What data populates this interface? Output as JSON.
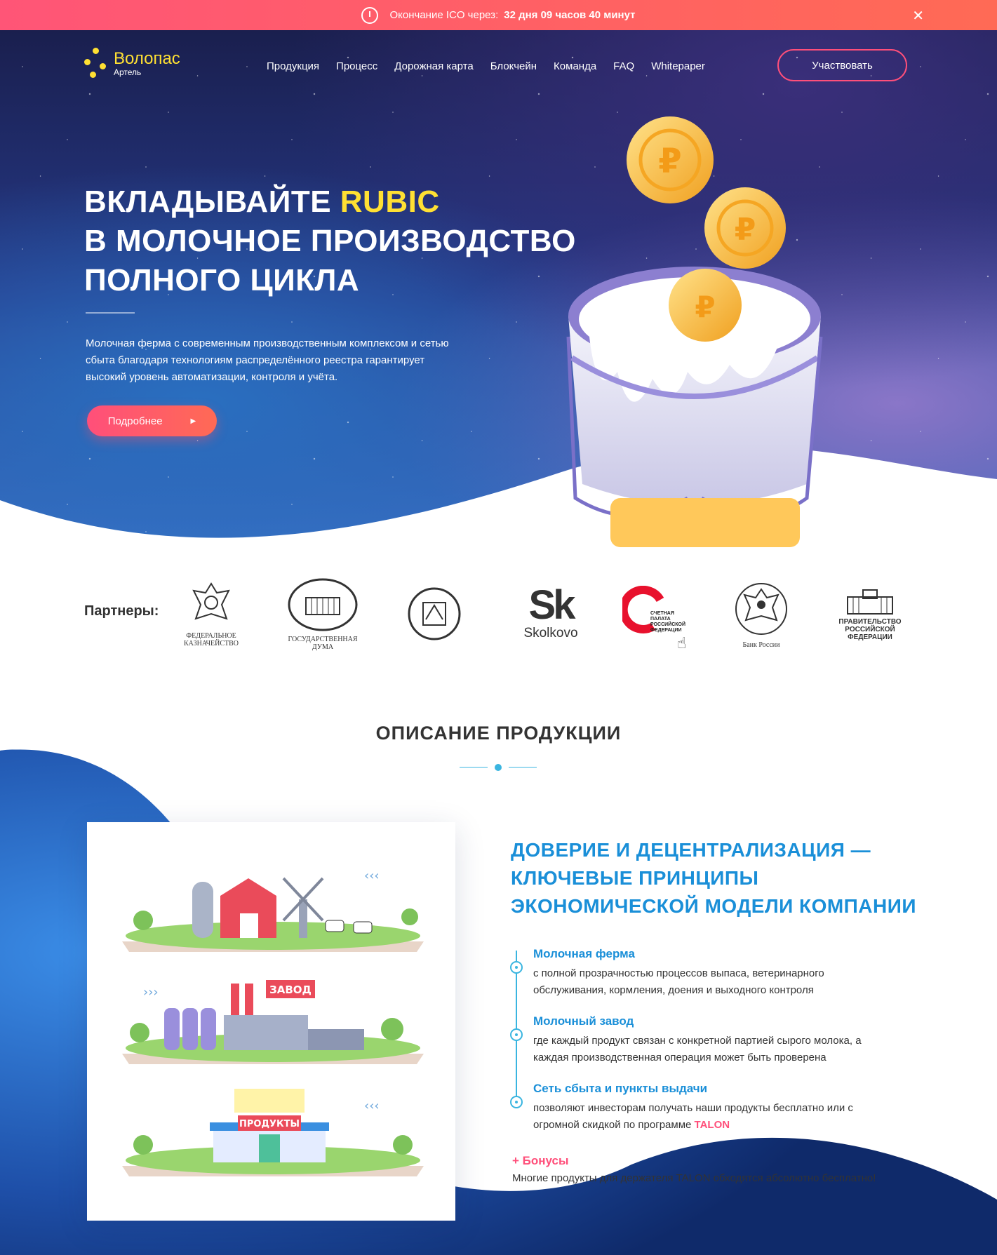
{
  "topbar": {
    "label": "Окончание ICO через:",
    "countdown": "32 дня 09 часов 40 минут",
    "close": "✕"
  },
  "logo": {
    "name": "Волопас",
    "subtitle": "Артель"
  },
  "nav": [
    "Продукция",
    "Процесс",
    "Дорожная карта",
    "Блокчейн",
    "Команда",
    "FAQ",
    "Whitepaper"
  ],
  "header": {
    "cta": "Участвовать"
  },
  "hero": {
    "title_line1_prefix": "ВКЛАДЫВАЙТЕ ",
    "title_line1_accent": "RUBIC",
    "title_line2": "В МОЛОЧНОЕ ПРОИЗВОДСТВО",
    "title_line3": "ПОЛНОГО ЦИКЛА",
    "description": "Молочная ферма с современным производственным комплексом и сетью сбыта благодаря технологиям распределённого реестра гарантирует высокий уровень автоматизации, контроля и учёта.",
    "button": "Подробнее",
    "button_icon": "▶"
  },
  "partners": {
    "label": "Партнеры:",
    "items": [
      {
        "name": "treasury",
        "caption": "ФЕДЕРАЛЬНОЕ КАЗНАЧЕЙСТВО"
      },
      {
        "name": "duma",
        "caption": "ГОСУДАРСТВЕННАЯ ДУМА"
      },
      {
        "name": "emblem",
        "caption": ""
      },
      {
        "name": "skolkovo",
        "caption": "Skolkovo",
        "mark": "Sk"
      },
      {
        "name": "audit-chamber",
        "caption": "СЧЕТНАЯ ПАЛАТА РОССИЙСКОЙ ФЕДЕРАЦИИ"
      },
      {
        "name": "central-bank",
        "caption": "Банк России"
      },
      {
        "name": "government",
        "caption": "ПРАВИТЕЛЬСТВО РОССИЙСКОЙ ФЕДЕРАЦИИ"
      }
    ]
  },
  "products": {
    "section_title": "ОПИСАНИЕ ПРОДУКЦИИ",
    "scene_labels": {
      "factory": "ЗАВОД",
      "shop": "ПРОДУКТЫ"
    },
    "info_title_line1": "ДОВЕРИЕ И ДЕЦЕНТРАЛИЗАЦИЯ —",
    "info_title_line2": "КЛЮЧЕВЫЕ ПРИНЦИПЫ",
    "info_title_line3": "ЭКОНОМИЧЕСКОЙ МОДЕЛИ КОМПАНИИ",
    "items": [
      {
        "title": "Молочная ферма",
        "text": "с полной прозрачностью процессов выпаса, ветеринарного обслуживания, кормления, доения и выходного контроля"
      },
      {
        "title": "Молочный завод",
        "text": "где каждый продукт связан с конкретной партией сырого молока, а каждая производственная операция может быть проверена"
      },
      {
        "title": "Сеть сбыта и пункты выдачи",
        "text": "позволяют инвесторам получать наши продукты бесплатно или с огромной  скидкой по программе ",
        "highlight": "TALON"
      }
    ],
    "bonus_title": "+ Бонусы",
    "bonus_text": "Многие продукты для держателя TALON обходятся абсолютно бесплатно!"
  },
  "colors": {
    "accent_pink": "#ff4f7a",
    "accent_yellow": "#ffe033",
    "accent_blue": "#1a8fd8"
  }
}
